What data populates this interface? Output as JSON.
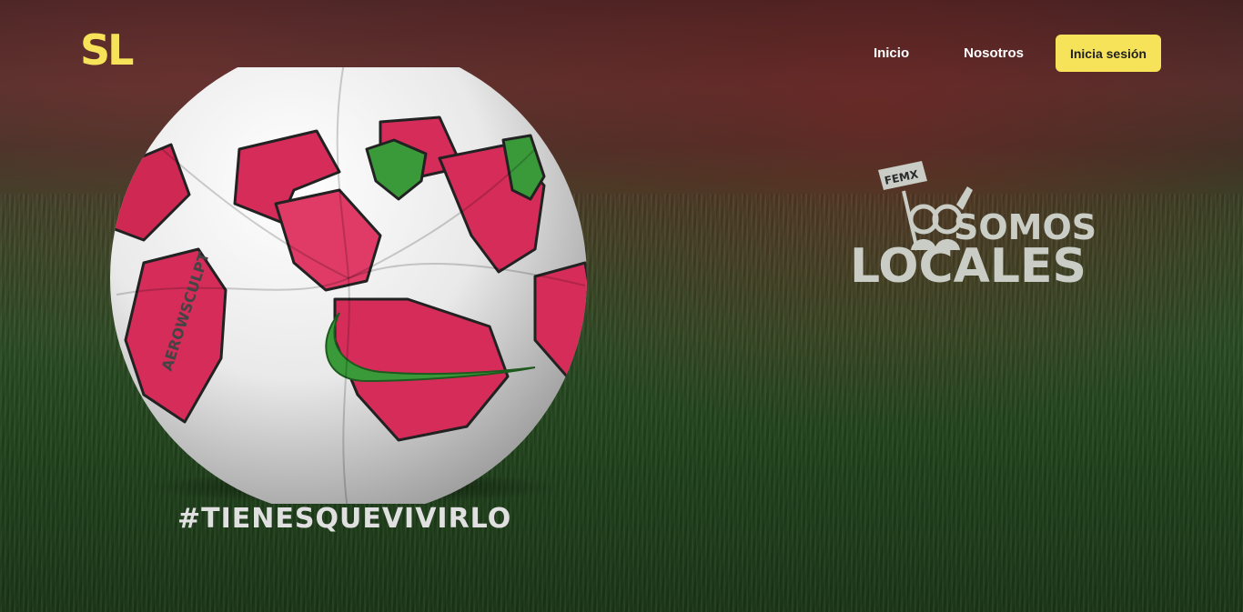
{
  "header": {
    "logo_text": "SL",
    "nav": {
      "home_label": "Inicio",
      "about_label": "Nosotros",
      "login_label": "Inicia sesión"
    }
  },
  "hero": {
    "brand": {
      "flag_text": "FEMX",
      "line1": "SOMOS",
      "line2": "LOCALES"
    },
    "hashtag": "#TIENESQUEVIVIRLO",
    "ball_print": "AEROWSCULPT"
  },
  "colors": {
    "accent": "#f6e35a",
    "brand_gray": "#c9cdc5",
    "grass": "#2b5225",
    "ball_pink": "#d62c5a",
    "ball_green": "#3a9a3a"
  },
  "icons": {
    "ball": "soccer-ball-image",
    "brand": "somos-locales-logo"
  }
}
